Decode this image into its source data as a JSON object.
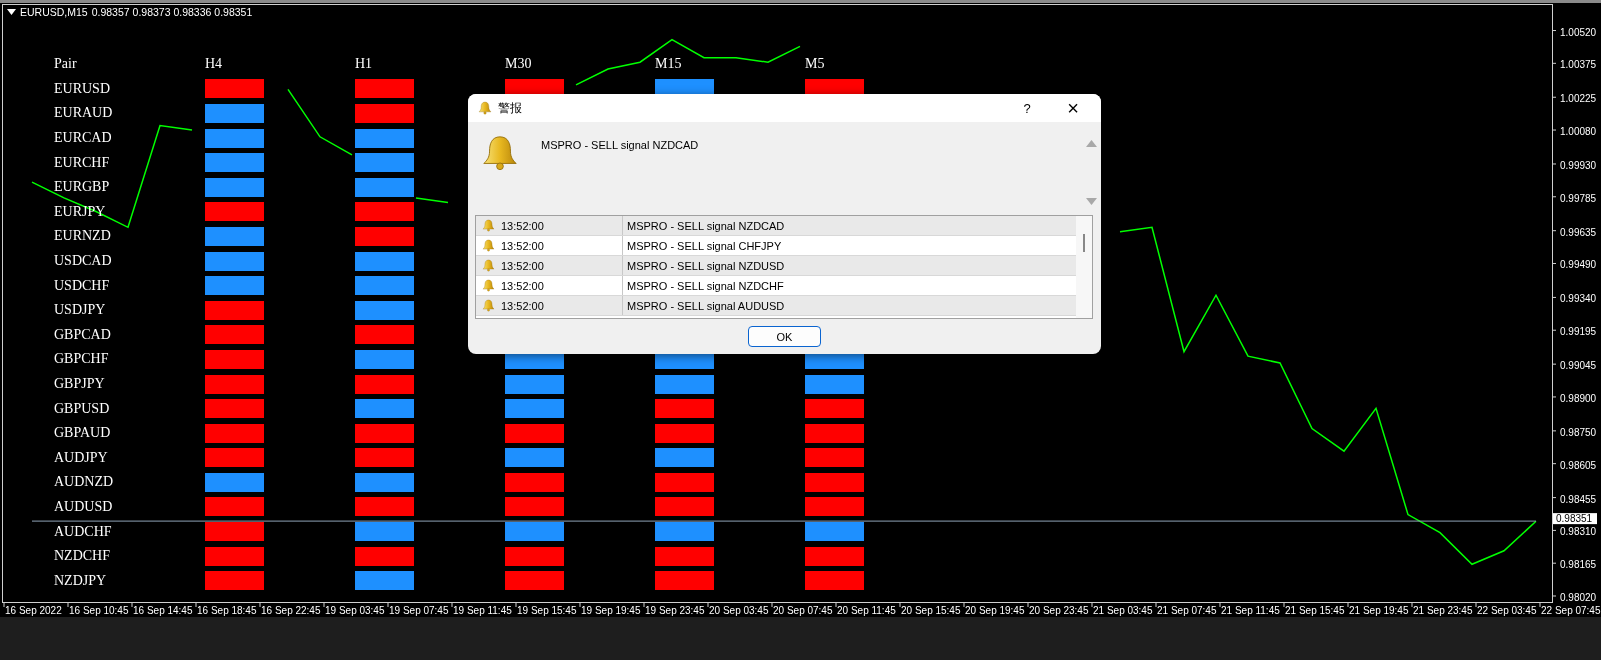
{
  "header": {
    "symbol": "EURUSD,M15",
    "ohlc": "0.98357 0.98373 0.98336 0.98351"
  },
  "matrix": {
    "header": "Pair",
    "timeframes": [
      "H4",
      "H1",
      "M30",
      "M15",
      "M5"
    ],
    "rows": [
      {
        "pair": "EURUSD",
        "cells": [
          {
            "color": "#ff0000"
          },
          {
            "color": "#ff0000"
          },
          {
            "color": "#ff0000"
          },
          {
            "color": "#1e90ff"
          },
          {
            "color": "#ff0000"
          }
        ]
      },
      {
        "pair": "EURAUD",
        "cells": [
          {
            "color": "#1e90ff"
          },
          {
            "color": "#ff0000"
          }
        ]
      },
      {
        "pair": "EURCAD",
        "cells": [
          {
            "color": "#1e90ff"
          },
          {
            "color": "#1e90ff"
          }
        ]
      },
      {
        "pair": "EURCHF",
        "cells": [
          {
            "color": "#1e90ff"
          },
          {
            "color": "#1e90ff"
          }
        ]
      },
      {
        "pair": "EURGBP",
        "cells": [
          {
            "color": "#1e90ff"
          },
          {
            "color": "#1e90ff"
          }
        ]
      },
      {
        "pair": "EURJPY",
        "cells": [
          {
            "color": "#ff0000"
          },
          {
            "color": "#ff0000"
          }
        ]
      },
      {
        "pair": "EURNZD",
        "cells": [
          {
            "color": "#1e90ff"
          },
          {
            "color": "#ff0000"
          }
        ]
      },
      {
        "pair": "USDCAD",
        "cells": [
          {
            "color": "#1e90ff"
          },
          {
            "color": "#1e90ff"
          }
        ]
      },
      {
        "pair": "USDCHF",
        "cells": [
          {
            "color": "#1e90ff"
          },
          {
            "color": "#1e90ff"
          }
        ]
      },
      {
        "pair": "USDJPY",
        "cells": [
          {
            "color": "#ff0000"
          },
          {
            "color": "#1e90ff"
          }
        ]
      },
      {
        "pair": "GBPCAD",
        "cells": [
          {
            "color": "#ff0000"
          },
          {
            "color": "#ff0000"
          }
        ]
      },
      {
        "pair": "GBPCHF",
        "cells": [
          {
            "color": "#ff0000"
          },
          {
            "color": "#1e90ff"
          },
          {
            "color": "#1e90ff"
          },
          {
            "color": "#1e90ff"
          },
          {
            "color": "#1e90ff"
          }
        ]
      },
      {
        "pair": "GBPJPY",
        "cells": [
          {
            "color": "#ff0000"
          },
          {
            "color": "#ff0000"
          },
          {
            "color": "#1e90ff"
          },
          {
            "color": "#1e90ff"
          },
          {
            "color": "#1e90ff"
          }
        ]
      },
      {
        "pair": "GBPUSD",
        "cells": [
          {
            "color": "#ff0000"
          },
          {
            "color": "#1e90ff"
          },
          {
            "color": "#1e90ff"
          },
          {
            "color": "#ff0000"
          },
          {
            "color": "#ff0000"
          }
        ]
      },
      {
        "pair": "GBPAUD",
        "cells": [
          {
            "color": "#ff0000"
          },
          {
            "color": "#ff0000"
          },
          {
            "color": "#ff0000"
          },
          {
            "color": "#ff0000"
          },
          {
            "color": "#ff0000"
          }
        ]
      },
      {
        "pair": "AUDJPY",
        "cells": [
          {
            "color": "#ff0000"
          },
          {
            "color": "#ff0000"
          },
          {
            "color": "#1e90ff"
          },
          {
            "color": "#1e90ff"
          },
          {
            "color": "#ff0000"
          }
        ]
      },
      {
        "pair": "AUDNZD",
        "cells": [
          {
            "color": "#1e90ff"
          },
          {
            "color": "#1e90ff"
          },
          {
            "color": "#ff0000"
          },
          {
            "color": "#ff0000"
          },
          {
            "color": "#ff0000"
          }
        ]
      },
      {
        "pair": "AUDUSD",
        "cells": [
          {
            "color": "#ff0000"
          },
          {
            "color": "#ff0000"
          },
          {
            "color": "#ff0000"
          },
          {
            "color": "#ff0000"
          },
          {
            "color": "#ff0000"
          }
        ]
      },
      {
        "pair": "AUDCHF",
        "cells": [
          {
            "color": "#ff0000"
          },
          {
            "color": "#1e90ff"
          },
          {
            "color": "#1e90ff"
          },
          {
            "color": "#1e90ff"
          },
          {
            "color": "#1e90ff"
          }
        ]
      },
      {
        "pair": "NZDCHF",
        "cells": [
          {
            "color": "#ff0000"
          },
          {
            "color": "#ff0000"
          },
          {
            "color": "#ff0000"
          },
          {
            "color": "#ff0000"
          },
          {
            "color": "#ff0000"
          }
        ]
      },
      {
        "pair": "NZDJPY",
        "cells": [
          {
            "color": "#ff0000"
          },
          {
            "color": "#1e90ff"
          },
          {
            "color": "#ff0000"
          },
          {
            "color": "#ff0000"
          },
          {
            "color": "#ff0000"
          }
        ]
      }
    ]
  },
  "chart_data": {
    "type": "line",
    "categories": [
      "16 Sep 2022",
      null,
      "16 Sep 10:45",
      null,
      "16 Sep 14:45",
      null,
      "16 Sep 18:45",
      null,
      "16 Sep 22:45",
      null,
      "19 Sep 03:45",
      null,
      "19 Sep 07:45",
      null,
      "19 Sep 11:45",
      null,
      "19 Sep 15:45",
      null,
      "19 Sep 19:45",
      null,
      "19 Sep 23:45",
      null,
      "20 Sep 03:45",
      null,
      "20 Sep 07:45",
      null,
      "20 Sep 11:45",
      null,
      "20 Sep 15:45",
      null,
      "20 Sep 19:45",
      null,
      "20 Sep 23:45",
      null,
      "21 Sep 03:45",
      null,
      "21 Sep 07:45",
      null,
      "21 Sep 11:45",
      null,
      "21 Sep 15:45",
      null,
      "21 Sep 19:45",
      null,
      "21 Sep 23:45",
      null,
      "22 Sep 03:45",
      null,
      "22 Sep 07:45"
    ],
    "series": [
      {
        "color": "#00ff00",
        "values": [
          0.9985,
          0.9978,
          0.9972,
          0.9965,
          1.001,
          1.0008,
          null,
          null,
          1.0026,
          1.0005,
          0.9997,
          null,
          0.9978,
          0.9976,
          null,
          null,
          null,
          1.0028,
          1.0035,
          1.0038,
          1.0048,
          1.004,
          1.004,
          1.0038,
          1.0045,
          null,
          null,
          null,
          null,
          null,
          null,
          null,
          null,
          null,
          0.9963,
          0.9965,
          0.991,
          0.9935,
          0.9908,
          0.9905,
          0.9876,
          0.9866,
          0.9885,
          0.9838,
          0.983,
          0.9816,
          0.9822,
          0.9835,
          null
        ]
      },
      {
        "color": "#8fa3b8",
        "values": [
          0.98351,
          0.98351,
          0.98351,
          0.98351,
          0.98351,
          0.98351,
          0.98351,
          0.98351,
          0.98351,
          0.98351,
          0.98351,
          0.98351,
          0.98351,
          0.98351,
          0.98351,
          0.98351,
          0.98351,
          0.98351,
          0.98351,
          0.98351,
          0.98351,
          0.98351,
          0.98351,
          0.98351,
          0.98351,
          0.98351,
          0.98351,
          0.98351,
          0.98351,
          0.98351,
          0.98351,
          0.98351,
          0.98351,
          0.98351,
          0.98351,
          0.98351,
          0.98351,
          0.98351,
          0.98351,
          0.98351,
          0.98351,
          0.98351,
          0.98351,
          0.98351,
          0.98351,
          0.98351,
          0.98351,
          0.98351,
          null
        ]
      }
    ],
    "ylim": [
      0.97989,
      1.00624
    ],
    "yticks": [
      {
        "value": 1.0052,
        "label": "1.00520"
      },
      {
        "value": 1.00375,
        "label": "1.00375"
      },
      {
        "value": 1.00225,
        "label": "1.00225"
      },
      {
        "value": 1.0008,
        "label": "1.00080"
      },
      {
        "value": 0.9993,
        "label": "0.99930"
      },
      {
        "value": 0.99785,
        "label": "0.99785"
      },
      {
        "value": 0.99635,
        "label": "0.99635"
      },
      {
        "value": 0.9949,
        "label": "0.99490"
      },
      {
        "value": 0.9934,
        "label": "0.99340"
      },
      {
        "value": 0.99195,
        "label": "0.99195"
      },
      {
        "value": 0.99045,
        "label": "0.99045"
      },
      {
        "value": 0.989,
        "label": "0.98900"
      },
      {
        "value": 0.9875,
        "label": "0.98750"
      },
      {
        "value": 0.98605,
        "label": "0.98605"
      },
      {
        "value": 0.98455,
        "label": "0.98455"
      },
      {
        "value": 0.9831,
        "label": "0.98310"
      },
      {
        "value": 0.98165,
        "label": "0.98165"
      },
      {
        "value": 0.9802,
        "label": "0.98020"
      }
    ]
  },
  "price_tag": "0.98351",
  "dialog": {
    "title": "警报",
    "help": "?",
    "close": "×",
    "message": "MSPRO - SELL signal NZDCAD",
    "alerts": [
      {
        "time": "13:52:00",
        "message": "MSPRO - SELL signal NZDCAD"
      },
      {
        "time": "13:52:00",
        "message": "MSPRO - SELL signal CHFJPY"
      },
      {
        "time": "13:52:00",
        "message": "MSPRO - SELL signal NZDUSD"
      },
      {
        "time": "13:52:00",
        "message": "MSPRO - SELL signal NZDCHF"
      },
      {
        "time": "13:52:00",
        "message": "MSPRO - SELL signal AUDUSD"
      }
    ],
    "button": "OK"
  }
}
